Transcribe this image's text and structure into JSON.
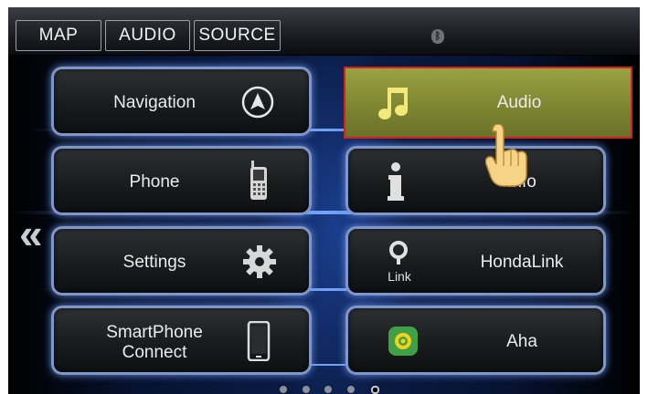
{
  "topbar": {
    "tabs": [
      {
        "label": "MAP"
      },
      {
        "label": "AUDIO"
      },
      {
        "label": "SOURCE"
      }
    ],
    "bluetooth_icon": "bluetooth-icon"
  },
  "menu": {
    "left": [
      {
        "label": "Navigation",
        "icon": "compass-arrow-icon"
      },
      {
        "label": "Phone",
        "icon": "cellphone-icon"
      },
      {
        "label": "Settings",
        "icon": "gear-icon"
      },
      {
        "label_line1": "SmartPhone",
        "label_line2": "Connect",
        "icon": "smartphone-icon"
      }
    ],
    "right": [
      {
        "label": "Audio",
        "icon": "music-note-icon",
        "selected": true
      },
      {
        "label": "Info",
        "icon": "info-icon"
      },
      {
        "label": "HondaLink",
        "icon": "hondalink-icon",
        "icon_text": "Link"
      },
      {
        "label": "Aha",
        "icon": "aha-icon"
      }
    ]
  },
  "pagination": {
    "pages": 5,
    "current": 5
  },
  "colors": {
    "selected_fill": "#8f9638",
    "selected_border": "#d81f1f",
    "button_glow": "#7f96c8"
  }
}
